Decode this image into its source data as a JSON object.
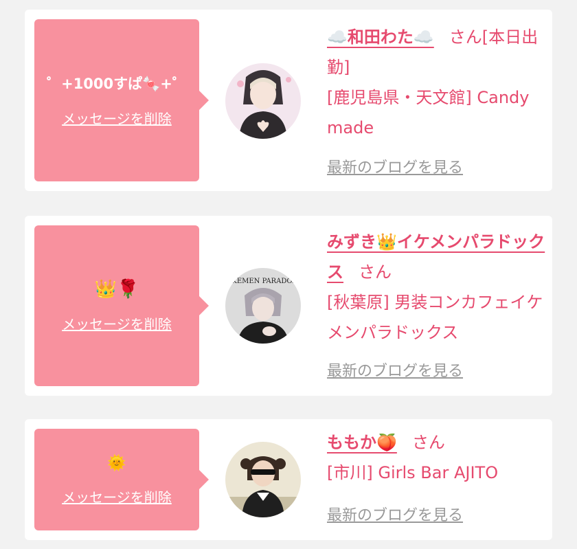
{
  "items": [
    {
      "message": "゜+1000すぱ🍬+゜",
      "delete_label": "メッセージを削除",
      "name": "☁️和田わた☁️",
      "san": "さん",
      "tag": "[本日出勤]",
      "shop": "[鹿児島県・天文館] Candy made",
      "blog_label": "最新のブログを見る"
    },
    {
      "message": "👑🌹",
      "delete_label": "メッセージを削除",
      "name": "みずき👑イケメンパラドックス",
      "san": "さん",
      "shop": "[秋葉原] 男装コンカフェイケメンパラドックス",
      "blog_label": "最新のブログを見る",
      "avatar_text": "IKEMEN PARADOX"
    },
    {
      "message": "🌞",
      "delete_label": "メッセージを削除",
      "name": "ももか🍑",
      "san": "さん",
      "shop": "[市川] Girls Bar AJITO",
      "blog_label": "最新のブログを見る"
    }
  ],
  "colors": {
    "bubble": "#f8919e",
    "accent": "#e64a6e",
    "muted": "#999999",
    "page_bg": "#f2f2f2"
  }
}
